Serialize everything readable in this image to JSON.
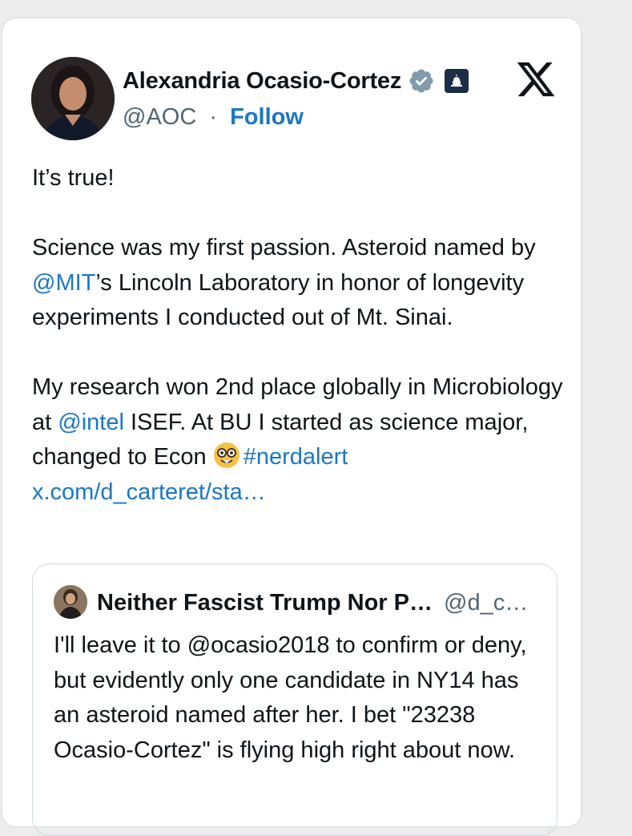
{
  "author": {
    "name": "Alexandria Ocasio-Cortez",
    "handle": "@AOC",
    "separator": "·",
    "follow_label": "Follow"
  },
  "icons": {
    "verified": "verified-badge-icon",
    "gov_badge": "government-capitol-icon",
    "x_logo": "x-logo-icon",
    "emoji": "nerd-face-emoji-icon"
  },
  "colors": {
    "link": "#1d76c2",
    "text": "#0f1419",
    "muted": "#536471",
    "verified": "#829aab"
  },
  "tweet": {
    "line1": "It’s true!",
    "p2_before": "Science was my first passion. Asteroid named by ",
    "mention_mit": "@MIT",
    "p2_after": "’s Lincoln Laboratory in honor of longevity experiments I conducted out of Mt. Sinai.",
    "p3_before": "My research won 2nd place globally in Microbiology at ",
    "mention_intel": "@intel",
    "p3_after": " ISEF. At BU I started as science major, changed to Econ ",
    "hashtag": "#nerdalert",
    "url": "x.com/d_carteret/sta…"
  },
  "quote": {
    "name": "Neither Fascist Trump Nor P…",
    "handle": "@d_c…",
    "text": "I'll leave it to @ocasio2018 to confirm or deny, but evidently only one candidate in NY14 has an asteroid named after her. I bet \"23238 Ocasio-Cortez\" is flying high right about now."
  }
}
